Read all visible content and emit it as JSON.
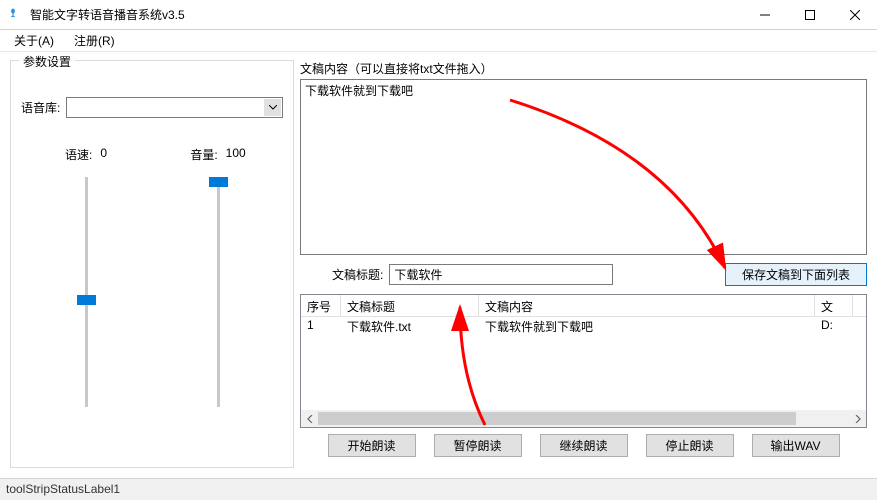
{
  "window": {
    "title": "智能文字转语音播音系统v3.5"
  },
  "menu": {
    "about": "关于(A)",
    "register": "注册(R)"
  },
  "params": {
    "legend": "参数设置",
    "voice_lib_label": "语音库:",
    "speed_label": "语速:",
    "speed_value": "0",
    "volume_label": "音量:",
    "volume_value": "100"
  },
  "content_area": {
    "label": "文稿内容（可以直接将txt文件拖入）",
    "text": "下载软件就到下载吧"
  },
  "doc_title": {
    "label": "文稿标题:",
    "value": "下载软件",
    "save_btn": "保存文稿到下面列表"
  },
  "list": {
    "headers": {
      "seq": "序号",
      "title": "文稿标题",
      "content": "文稿内容",
      "path": "文"
    },
    "rows": [
      {
        "seq": "1",
        "title": "下载软件.txt",
        "content": "下载软件就到下载吧",
        "path": "D:"
      }
    ]
  },
  "buttons": {
    "start": "开始朗读",
    "pause": "暂停朗读",
    "resume": "继续朗读",
    "stop": "停止朗读",
    "export": "输出WAV"
  },
  "status": "toolStripStatusLabel1"
}
